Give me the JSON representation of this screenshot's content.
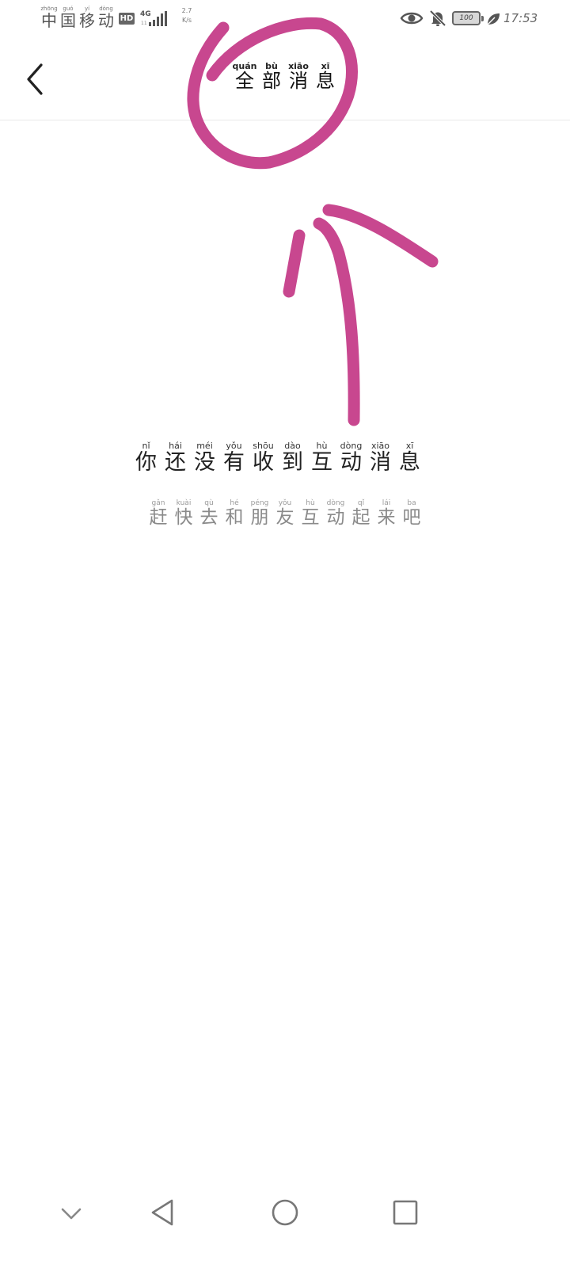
{
  "status_bar": {
    "carrier": [
      {
        "pinyin": "zhōng",
        "hanzi": "中"
      },
      {
        "pinyin": "guó",
        "hanzi": "国"
      },
      {
        "pinyin": "yí",
        "hanzi": "移"
      },
      {
        "pinyin": "dòng",
        "hanzi": "动"
      }
    ],
    "hd_label": "HD",
    "network_type": "4G",
    "network_sub": "11",
    "speed_value": "2.7",
    "speed_unit": "K/s",
    "battery_level": "100",
    "time": "17:53"
  },
  "header": {
    "title": [
      {
        "pinyin": "quán",
        "hanzi": "全"
      },
      {
        "pinyin": "bù",
        "hanzi": "部"
      },
      {
        "pinyin": "xiāo",
        "hanzi": "消"
      },
      {
        "pinyin": "xī",
        "hanzi": "息"
      }
    ]
  },
  "empty_state": {
    "main": [
      {
        "pinyin": "nǐ",
        "hanzi": "你"
      },
      {
        "pinyin": "hái",
        "hanzi": "还"
      },
      {
        "pinyin": "méi",
        "hanzi": "没"
      },
      {
        "pinyin": "yǒu",
        "hanzi": "有"
      },
      {
        "pinyin": "shōu",
        "hanzi": "收"
      },
      {
        "pinyin": "dào",
        "hanzi": "到"
      },
      {
        "pinyin": "hù",
        "hanzi": "互"
      },
      {
        "pinyin": "dòng",
        "hanzi": "动"
      },
      {
        "pinyin": "xiāo",
        "hanzi": "消"
      },
      {
        "pinyin": "xī",
        "hanzi": "息"
      }
    ],
    "sub": [
      {
        "pinyin": "gǎn",
        "hanzi": "赶"
      },
      {
        "pinyin": "kuài",
        "hanzi": "快"
      },
      {
        "pinyin": "qù",
        "hanzi": "去"
      },
      {
        "pinyin": "hé",
        "hanzi": "和"
      },
      {
        "pinyin": "péng",
        "hanzi": "朋"
      },
      {
        "pinyin": "yǒu",
        "hanzi": "友"
      },
      {
        "pinyin": "hù",
        "hanzi": "互"
      },
      {
        "pinyin": "dòng",
        "hanzi": "动"
      },
      {
        "pinyin": "qǐ",
        "hanzi": "起"
      },
      {
        "pinyin": "lái",
        "hanzi": "来"
      },
      {
        "pinyin": "ba",
        "hanzi": "吧"
      }
    ]
  },
  "icons": {
    "back": "chevron-left-icon",
    "signal": "signal-bars-icon",
    "eye": "eye-icon",
    "bell_muted": "bell-off-icon",
    "battery": "battery-icon",
    "leaf": "leaf-icon",
    "nav_collapse": "chevron-down-icon",
    "nav_back": "triangle-back-icon",
    "nav_home": "circle-home-icon",
    "nav_recents": "square-recents-icon"
  },
  "colors": {
    "annotation": "#c8478f",
    "background": "#ffffff",
    "text_primary": "#222222",
    "text_secondary": "#8a8a8a"
  }
}
